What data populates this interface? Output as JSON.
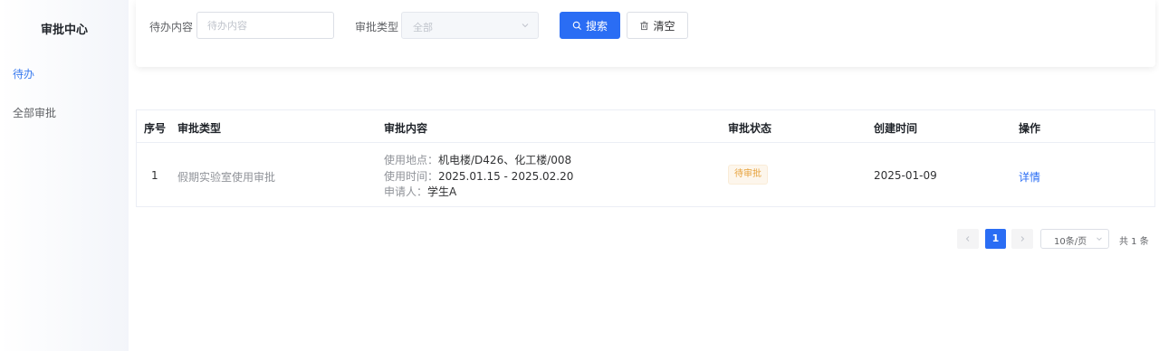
{
  "sidebar": {
    "title": "审批中心",
    "items": [
      {
        "label": "待办",
        "active": true
      },
      {
        "label": "全部审批",
        "active": false
      }
    ]
  },
  "search": {
    "content_label": "待办内容",
    "content_placeholder": "待办内容",
    "type_label": "审批类型",
    "type_value": "全部",
    "search_button": "搜索",
    "clear_button": "清空"
  },
  "table": {
    "headers": {
      "index": "序号",
      "type": "审批类型",
      "content": "审批内容",
      "status": "审批状态",
      "created": "创建时间",
      "action": "操作"
    },
    "rows": [
      {
        "index": "1",
        "type": "假期实验室使用审批",
        "location_key": "使用地点：",
        "location_val": "机电楼/D426、化工楼/008",
        "time_key": "使用时间：",
        "time_val": "2025.01.15 - 2025.02.20",
        "applicant_key": "申请人：",
        "applicant_val": "学生A",
        "status": "待审批",
        "created": "2025-01-09",
        "action": "详情"
      }
    ]
  },
  "pagination": {
    "current_page": "1",
    "page_size": "10条/页",
    "total_text": "共 1 条"
  },
  "colors": {
    "primary": "#2a6df4",
    "sidebar_active": "#3a7bef",
    "warning": "#e6a23c"
  }
}
